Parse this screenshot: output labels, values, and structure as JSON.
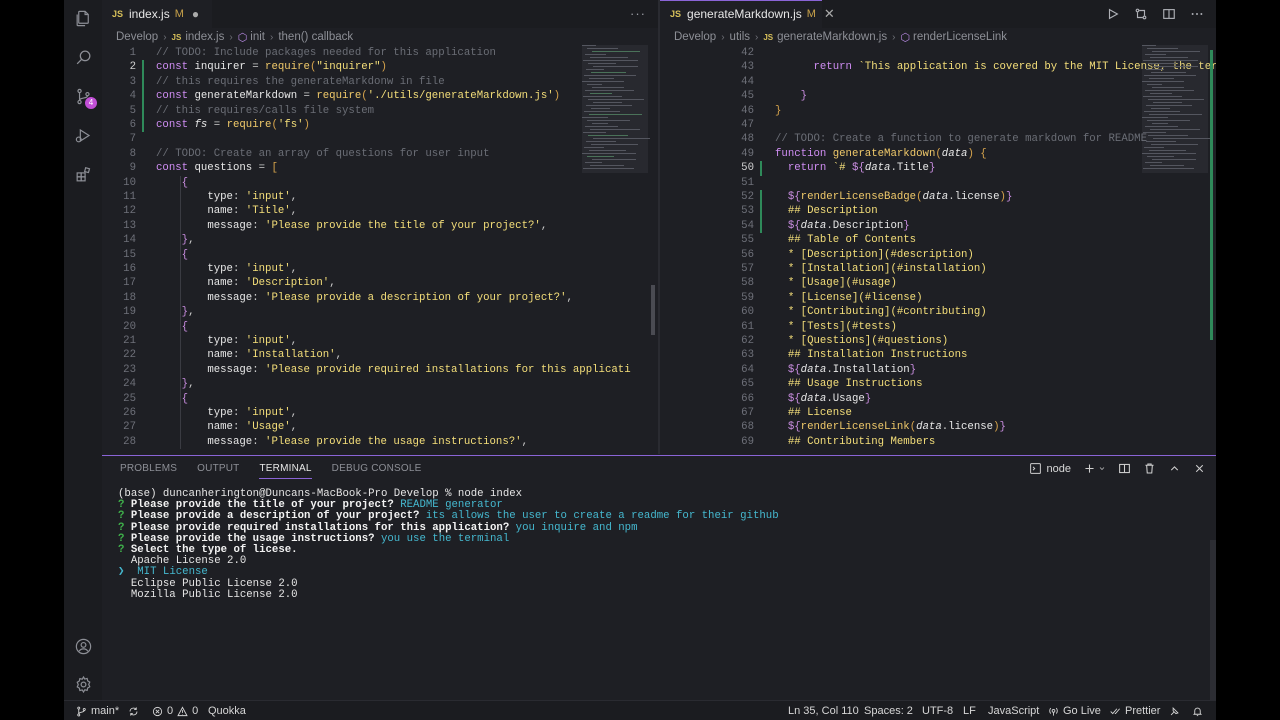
{
  "activity": {
    "items": [
      "explorer-icon",
      "search-icon",
      "source-control-icon",
      "run-debug-icon",
      "extensions-icon"
    ],
    "scm_badge": "4",
    "bottom": [
      "account-icon",
      "settings-gear-icon"
    ]
  },
  "left_editor": {
    "tab": {
      "label": "index.js",
      "badge": "M",
      "type": "JS"
    },
    "breadcrumb": [
      "Develop",
      "index.js",
      "init",
      "then() callback"
    ],
    "lines": [
      {
        "n": "1",
        "t": [
          [
            "c-cm",
            "// TODO: Include packages needed for this application"
          ]
        ]
      },
      {
        "n": "2",
        "t": [
          [
            "c-kw",
            "const "
          ],
          [
            "c-var",
            "inquirer "
          ],
          [
            "c-pun",
            "= "
          ],
          [
            "c-fn",
            "require"
          ],
          [
            "c-par",
            "("
          ],
          [
            "c-str",
            "\"inquirer\""
          ],
          [
            "c-par",
            ")"
          ]
        ]
      },
      {
        "n": "3",
        "t": [
          [
            "c-cm",
            "// this requires the generateMarkdonw in file"
          ]
        ]
      },
      {
        "n": "4",
        "t": [
          [
            "c-kw",
            "const "
          ],
          [
            "c-var",
            "generateMarkdown "
          ],
          [
            "c-pun",
            "= "
          ],
          [
            "c-fn",
            "require"
          ],
          [
            "c-par",
            "("
          ],
          [
            "c-str",
            "'./utils/generateMarkdown.js'"
          ],
          [
            "c-par",
            ")"
          ]
        ]
      },
      {
        "n": "5",
        "t": [
          [
            "c-cm",
            "// this requires/calls file system"
          ]
        ]
      },
      {
        "n": "6",
        "t": [
          [
            "c-kw",
            "const "
          ],
          [
            "c-var c-ital",
            "fs "
          ],
          [
            "c-pun",
            "= "
          ],
          [
            "c-fn",
            "require"
          ],
          [
            "c-par",
            "("
          ],
          [
            "c-str",
            "'fs'"
          ],
          [
            "c-par",
            ")"
          ]
        ]
      },
      {
        "n": "7",
        "t": []
      },
      {
        "n": "8",
        "t": [
          [
            "c-cm",
            "// TODO: Create an array of questions for user input"
          ]
        ]
      },
      {
        "n": "9",
        "t": [
          [
            "c-kw",
            "const "
          ],
          [
            "c-var",
            "questions "
          ],
          [
            "c-pun",
            "= "
          ],
          [
            "c-par",
            "["
          ]
        ]
      },
      {
        "n": "10",
        "t": [
          [
            "c-pun",
            "    "
          ],
          [
            "c-int",
            "{"
          ]
        ]
      },
      {
        "n": "11",
        "t": [
          [
            "c-pun",
            "        "
          ],
          [
            "c-key",
            "type"
          ],
          [
            "c-pun",
            ": "
          ],
          [
            "c-str",
            "'input'"
          ],
          [
            "c-pun",
            ","
          ]
        ]
      },
      {
        "n": "12",
        "t": [
          [
            "c-pun",
            "        "
          ],
          [
            "c-key",
            "name"
          ],
          [
            "c-pun",
            ": "
          ],
          [
            "c-str",
            "'Title'"
          ],
          [
            "c-pun",
            ","
          ]
        ]
      },
      {
        "n": "13",
        "t": [
          [
            "c-pun",
            "        "
          ],
          [
            "c-key",
            "message"
          ],
          [
            "c-pun",
            ": "
          ],
          [
            "c-str",
            "'Please provide the title of your project?'"
          ],
          [
            "c-pun",
            ","
          ]
        ]
      },
      {
        "n": "14",
        "t": [
          [
            "c-pun",
            "    "
          ],
          [
            "c-int",
            "}"
          ],
          [
            "c-pun",
            ","
          ]
        ]
      },
      {
        "n": "15",
        "t": [
          [
            "c-pun",
            "    "
          ],
          [
            "c-int",
            "{"
          ]
        ]
      },
      {
        "n": "16",
        "t": [
          [
            "c-pun",
            "        "
          ],
          [
            "c-key",
            "type"
          ],
          [
            "c-pun",
            ": "
          ],
          [
            "c-str",
            "'input'"
          ],
          [
            "c-pun",
            ","
          ]
        ]
      },
      {
        "n": "17",
        "t": [
          [
            "c-pun",
            "        "
          ],
          [
            "c-key",
            "name"
          ],
          [
            "c-pun",
            ": "
          ],
          [
            "c-str",
            "'Description'"
          ],
          [
            "c-pun",
            ","
          ]
        ]
      },
      {
        "n": "18",
        "t": [
          [
            "c-pun",
            "        "
          ],
          [
            "c-key",
            "message"
          ],
          [
            "c-pun",
            ": "
          ],
          [
            "c-str",
            "'Please provide a description of your project?'"
          ],
          [
            "c-pun",
            ","
          ]
        ]
      },
      {
        "n": "19",
        "t": [
          [
            "c-pun",
            "    "
          ],
          [
            "c-int",
            "}"
          ],
          [
            "c-pun",
            ","
          ]
        ]
      },
      {
        "n": "20",
        "t": [
          [
            "c-pun",
            "    "
          ],
          [
            "c-int",
            "{"
          ]
        ]
      },
      {
        "n": "21",
        "t": [
          [
            "c-pun",
            "        "
          ],
          [
            "c-key",
            "type"
          ],
          [
            "c-pun",
            ": "
          ],
          [
            "c-str",
            "'input'"
          ],
          [
            "c-pun",
            ","
          ]
        ]
      },
      {
        "n": "22",
        "t": [
          [
            "c-pun",
            "        "
          ],
          [
            "c-key",
            "name"
          ],
          [
            "c-pun",
            ": "
          ],
          [
            "c-str",
            "'Installation'"
          ],
          [
            "c-pun",
            ","
          ]
        ]
      },
      {
        "n": "23",
        "t": [
          [
            "c-pun",
            "        "
          ],
          [
            "c-key",
            "message"
          ],
          [
            "c-pun",
            ": "
          ],
          [
            "c-str",
            "'Please provide required installations for this applicati"
          ]
        ]
      },
      {
        "n": "24",
        "t": [
          [
            "c-pun",
            "    "
          ],
          [
            "c-int",
            "}"
          ],
          [
            "c-pun",
            ","
          ]
        ]
      },
      {
        "n": "25",
        "t": [
          [
            "c-pun",
            "    "
          ],
          [
            "c-int",
            "{"
          ]
        ]
      },
      {
        "n": "26",
        "t": [
          [
            "c-pun",
            "        "
          ],
          [
            "c-key",
            "type"
          ],
          [
            "c-pun",
            ": "
          ],
          [
            "c-str",
            "'input'"
          ],
          [
            "c-pun",
            ","
          ]
        ]
      },
      {
        "n": "27",
        "t": [
          [
            "c-pun",
            "        "
          ],
          [
            "c-key",
            "name"
          ],
          [
            "c-pun",
            ": "
          ],
          [
            "c-str",
            "'Usage'"
          ],
          [
            "c-pun",
            ","
          ]
        ]
      },
      {
        "n": "28",
        "t": [
          [
            "c-pun",
            "        "
          ],
          [
            "c-key",
            "message"
          ],
          [
            "c-pun",
            ": "
          ],
          [
            "c-str",
            "'Please provide the usage instructions?'"
          ],
          [
            "c-pun",
            ","
          ]
        ]
      }
    ],
    "current_line": "2"
  },
  "right_editor": {
    "tab": {
      "label": "generateMarkdown.js",
      "badge": "M",
      "type": "JS"
    },
    "breadcrumb": [
      "Develop",
      "utils",
      "generateMarkdown.js",
      "renderLicenseLink"
    ],
    "lines": [
      {
        "n": "42",
        "t": []
      },
      {
        "n": "43",
        "t": [
          [
            "c-pun",
            "      "
          ],
          [
            "c-kw",
            "return "
          ],
          [
            "c-str",
            "`This application is covered by the MIT License, the terms of w"
          ]
        ]
      },
      {
        "n": "44",
        "t": []
      },
      {
        "n": "45",
        "t": [
          [
            "c-pun",
            "    "
          ],
          [
            "c-int",
            "}"
          ]
        ]
      },
      {
        "n": "46",
        "t": [
          [
            "c-par",
            "}"
          ]
        ]
      },
      {
        "n": "47",
        "t": []
      },
      {
        "n": "48",
        "t": [
          [
            "c-cm",
            "// TODO: Create a function to generate markdown for README"
          ]
        ]
      },
      {
        "n": "49",
        "t": [
          [
            "c-kw",
            "function "
          ],
          [
            "c-fn",
            "generateMarkdown"
          ],
          [
            "c-par",
            "("
          ],
          [
            "c-var c-ital",
            "data"
          ],
          [
            "c-par",
            ") "
          ],
          [
            "c-par",
            "{"
          ]
        ]
      },
      {
        "n": "50",
        "t": [
          [
            "c-pun",
            "  "
          ],
          [
            "c-kw",
            "return "
          ],
          [
            "c-str",
            "`# "
          ],
          [
            "c-int",
            "${"
          ],
          [
            "c-var c-ital",
            "data"
          ],
          [
            "c-pun",
            "."
          ],
          [
            "c-var",
            "Title"
          ],
          [
            "c-int",
            "}"
          ]
        ]
      },
      {
        "n": "51",
        "t": []
      },
      {
        "n": "52",
        "t": [
          [
            "c-pun",
            "  "
          ],
          [
            "c-int",
            "${"
          ],
          [
            "c-fn",
            "renderLicenseBadge"
          ],
          [
            "c-par",
            "("
          ],
          [
            "c-var c-ital",
            "data"
          ],
          [
            "c-pun",
            "."
          ],
          [
            "c-var",
            "license"
          ],
          [
            "c-par",
            ")"
          ],
          [
            "c-int",
            "}"
          ]
        ]
      },
      {
        "n": "53",
        "t": [
          [
            "c-pun",
            "  "
          ],
          [
            "c-str",
            "## Description"
          ]
        ]
      },
      {
        "n": "54",
        "t": [
          [
            "c-pun",
            "  "
          ],
          [
            "c-int",
            "${"
          ],
          [
            "c-var c-ital",
            "data"
          ],
          [
            "c-pun",
            "."
          ],
          [
            "c-var",
            "Description"
          ],
          [
            "c-int",
            "}"
          ]
        ]
      },
      {
        "n": "55",
        "t": [
          [
            "c-pun",
            "  "
          ],
          [
            "c-str",
            "## Table of Contents"
          ]
        ]
      },
      {
        "n": "56",
        "t": [
          [
            "c-pun",
            "  "
          ],
          [
            "c-str",
            "* [Description](#description)"
          ]
        ]
      },
      {
        "n": "57",
        "t": [
          [
            "c-pun",
            "  "
          ],
          [
            "c-str",
            "* [Installation](#installation)"
          ]
        ]
      },
      {
        "n": "58",
        "t": [
          [
            "c-pun",
            "  "
          ],
          [
            "c-str",
            "* [Usage](#usage)"
          ]
        ]
      },
      {
        "n": "59",
        "t": [
          [
            "c-pun",
            "  "
          ],
          [
            "c-str",
            "* [License](#license)"
          ]
        ]
      },
      {
        "n": "60",
        "t": [
          [
            "c-pun",
            "  "
          ],
          [
            "c-str",
            "* [Contributing](#contributing)"
          ]
        ]
      },
      {
        "n": "61",
        "t": [
          [
            "c-pun",
            "  "
          ],
          [
            "c-str",
            "* [Tests](#tests)"
          ]
        ]
      },
      {
        "n": "62",
        "t": [
          [
            "c-pun",
            "  "
          ],
          [
            "c-str",
            "* [Questions](#questions)"
          ]
        ]
      },
      {
        "n": "63",
        "t": [
          [
            "c-pun",
            "  "
          ],
          [
            "c-str",
            "## Installation Instructions"
          ]
        ]
      },
      {
        "n": "64",
        "t": [
          [
            "c-pun",
            "  "
          ],
          [
            "c-int",
            "${"
          ],
          [
            "c-var c-ital",
            "data"
          ],
          [
            "c-pun",
            "."
          ],
          [
            "c-var",
            "Installation"
          ],
          [
            "c-int",
            "}"
          ]
        ]
      },
      {
        "n": "65",
        "t": [
          [
            "c-pun",
            "  "
          ],
          [
            "c-str",
            "## Usage Instructions"
          ]
        ]
      },
      {
        "n": "66",
        "t": [
          [
            "c-pun",
            "  "
          ],
          [
            "c-int",
            "${"
          ],
          [
            "c-var c-ital",
            "data"
          ],
          [
            "c-pun",
            "."
          ],
          [
            "c-var",
            "Usage"
          ],
          [
            "c-int",
            "}"
          ]
        ]
      },
      {
        "n": "67",
        "t": [
          [
            "c-pun",
            "  "
          ],
          [
            "c-str",
            "## License"
          ]
        ]
      },
      {
        "n": "68",
        "t": [
          [
            "c-pun",
            "  "
          ],
          [
            "c-int",
            "${"
          ],
          [
            "c-fn",
            "renderLicenseLink"
          ],
          [
            "c-par",
            "("
          ],
          [
            "c-var c-ital",
            "data"
          ],
          [
            "c-pun",
            "."
          ],
          [
            "c-var",
            "license"
          ],
          [
            "c-par",
            ")"
          ],
          [
            "c-int",
            "}"
          ]
        ]
      },
      {
        "n": "69",
        "t": [
          [
            "c-pun",
            "  "
          ],
          [
            "c-str",
            "## Contributing Members"
          ]
        ]
      }
    ],
    "current_line": "50"
  },
  "panel": {
    "tabs": [
      "PROBLEMS",
      "OUTPUT",
      "TERMINAL",
      "DEBUG CONSOLE"
    ],
    "active_tab": "TERMINAL",
    "terminal_name": "node",
    "terminal": [
      {
        "parts": [
          [
            "",
            "(base) duncanherington@Duncans-MacBook-Pro Develop % node index"
          ]
        ]
      },
      {
        "parts": [
          [
            "q",
            "? "
          ],
          [
            "b",
            "Please provide the title of your project? "
          ],
          [
            "ans",
            "README generator"
          ]
        ]
      },
      {
        "parts": [
          [
            "q",
            "? "
          ],
          [
            "b",
            "Please provide a description of your project? "
          ],
          [
            "ans",
            "its allows the user to create a readme for their github"
          ]
        ]
      },
      {
        "parts": [
          [
            "q",
            "? "
          ],
          [
            "b",
            "Please provide required installations for this application? "
          ],
          [
            "ans",
            "you inquire and npm"
          ]
        ]
      },
      {
        "parts": [
          [
            "q",
            "? "
          ],
          [
            "b",
            "Please provide the usage instructions? "
          ],
          [
            "ans",
            "you use the terminal"
          ]
        ]
      },
      {
        "parts": [
          [
            "q",
            "? "
          ],
          [
            "b",
            "Select the type of licese."
          ]
        ]
      },
      {
        "parts": [
          [
            "",
            "  Apache License 2.0"
          ]
        ]
      },
      {
        "parts": [
          [
            "sel",
            "❯  MIT License"
          ]
        ]
      },
      {
        "parts": [
          [
            "",
            "  Eclipse Public License 2.0"
          ]
        ]
      },
      {
        "parts": [
          [
            "",
            "  Mozilla Public License 2.0"
          ]
        ]
      }
    ]
  },
  "status": {
    "branch": "main*",
    "errors": "0",
    "warnings": "0",
    "quokka": "Quokka",
    "position": "Ln 35, Col 110",
    "spaces": "Spaces: 2",
    "encoding": "UTF-8",
    "eol": "LF",
    "language": "JavaScript",
    "golive": "Go Live",
    "prettier": "Prettier"
  },
  "colors": {
    "accent": "#8a64d6",
    "editor_bg": "#1e1f24",
    "git_added": "#2f8a5a",
    "prompt_green": "#3fb24b",
    "answer_cyan": "#45b8cf"
  }
}
